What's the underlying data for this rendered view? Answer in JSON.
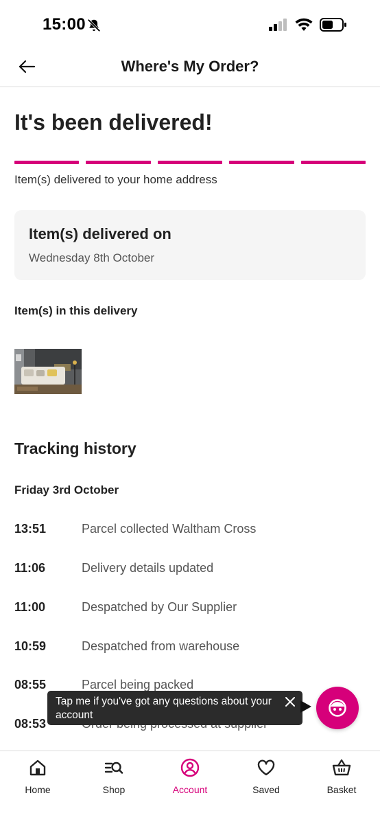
{
  "status_bar": {
    "time": "15:00"
  },
  "header": {
    "title": "Where's My Order?"
  },
  "main": {
    "heading": "It's been delivered!",
    "progress_steps": 5,
    "delivery_subtitle": "Item(s) delivered to your home address",
    "delivery_card": {
      "title": "Item(s) delivered on",
      "date": "Wednesday 8th October"
    },
    "items_label": "Item(s) in this delivery"
  },
  "tracking": {
    "title": "Tracking history",
    "date": "Friday 3rd October",
    "events": [
      {
        "time": "13:51",
        "description": "Parcel collected Waltham Cross"
      },
      {
        "time": "11:06",
        "description": "Delivery details updated"
      },
      {
        "time": "11:00",
        "description": "Despatched by Our Supplier"
      },
      {
        "time": "10:59",
        "description": "Despatched from warehouse"
      },
      {
        "time": "08:55",
        "description": "Parcel being packed"
      },
      {
        "time": "08:53",
        "description": "Order being processed at supplier"
      }
    ]
  },
  "tooltip": {
    "text": "Tap me if you've got any questions about your account"
  },
  "nav": {
    "items": [
      {
        "label": "Home",
        "icon": "home-icon"
      },
      {
        "label": "Shop",
        "icon": "shop-search-icon"
      },
      {
        "label": "Account",
        "icon": "account-icon",
        "active": true
      },
      {
        "label": "Saved",
        "icon": "heart-icon"
      },
      {
        "label": "Basket",
        "icon": "basket-icon"
      }
    ]
  },
  "colors": {
    "accent": "#d6007a",
    "tooltip_bg": "#2b2b2b",
    "card_bg": "#f5f5f5"
  }
}
